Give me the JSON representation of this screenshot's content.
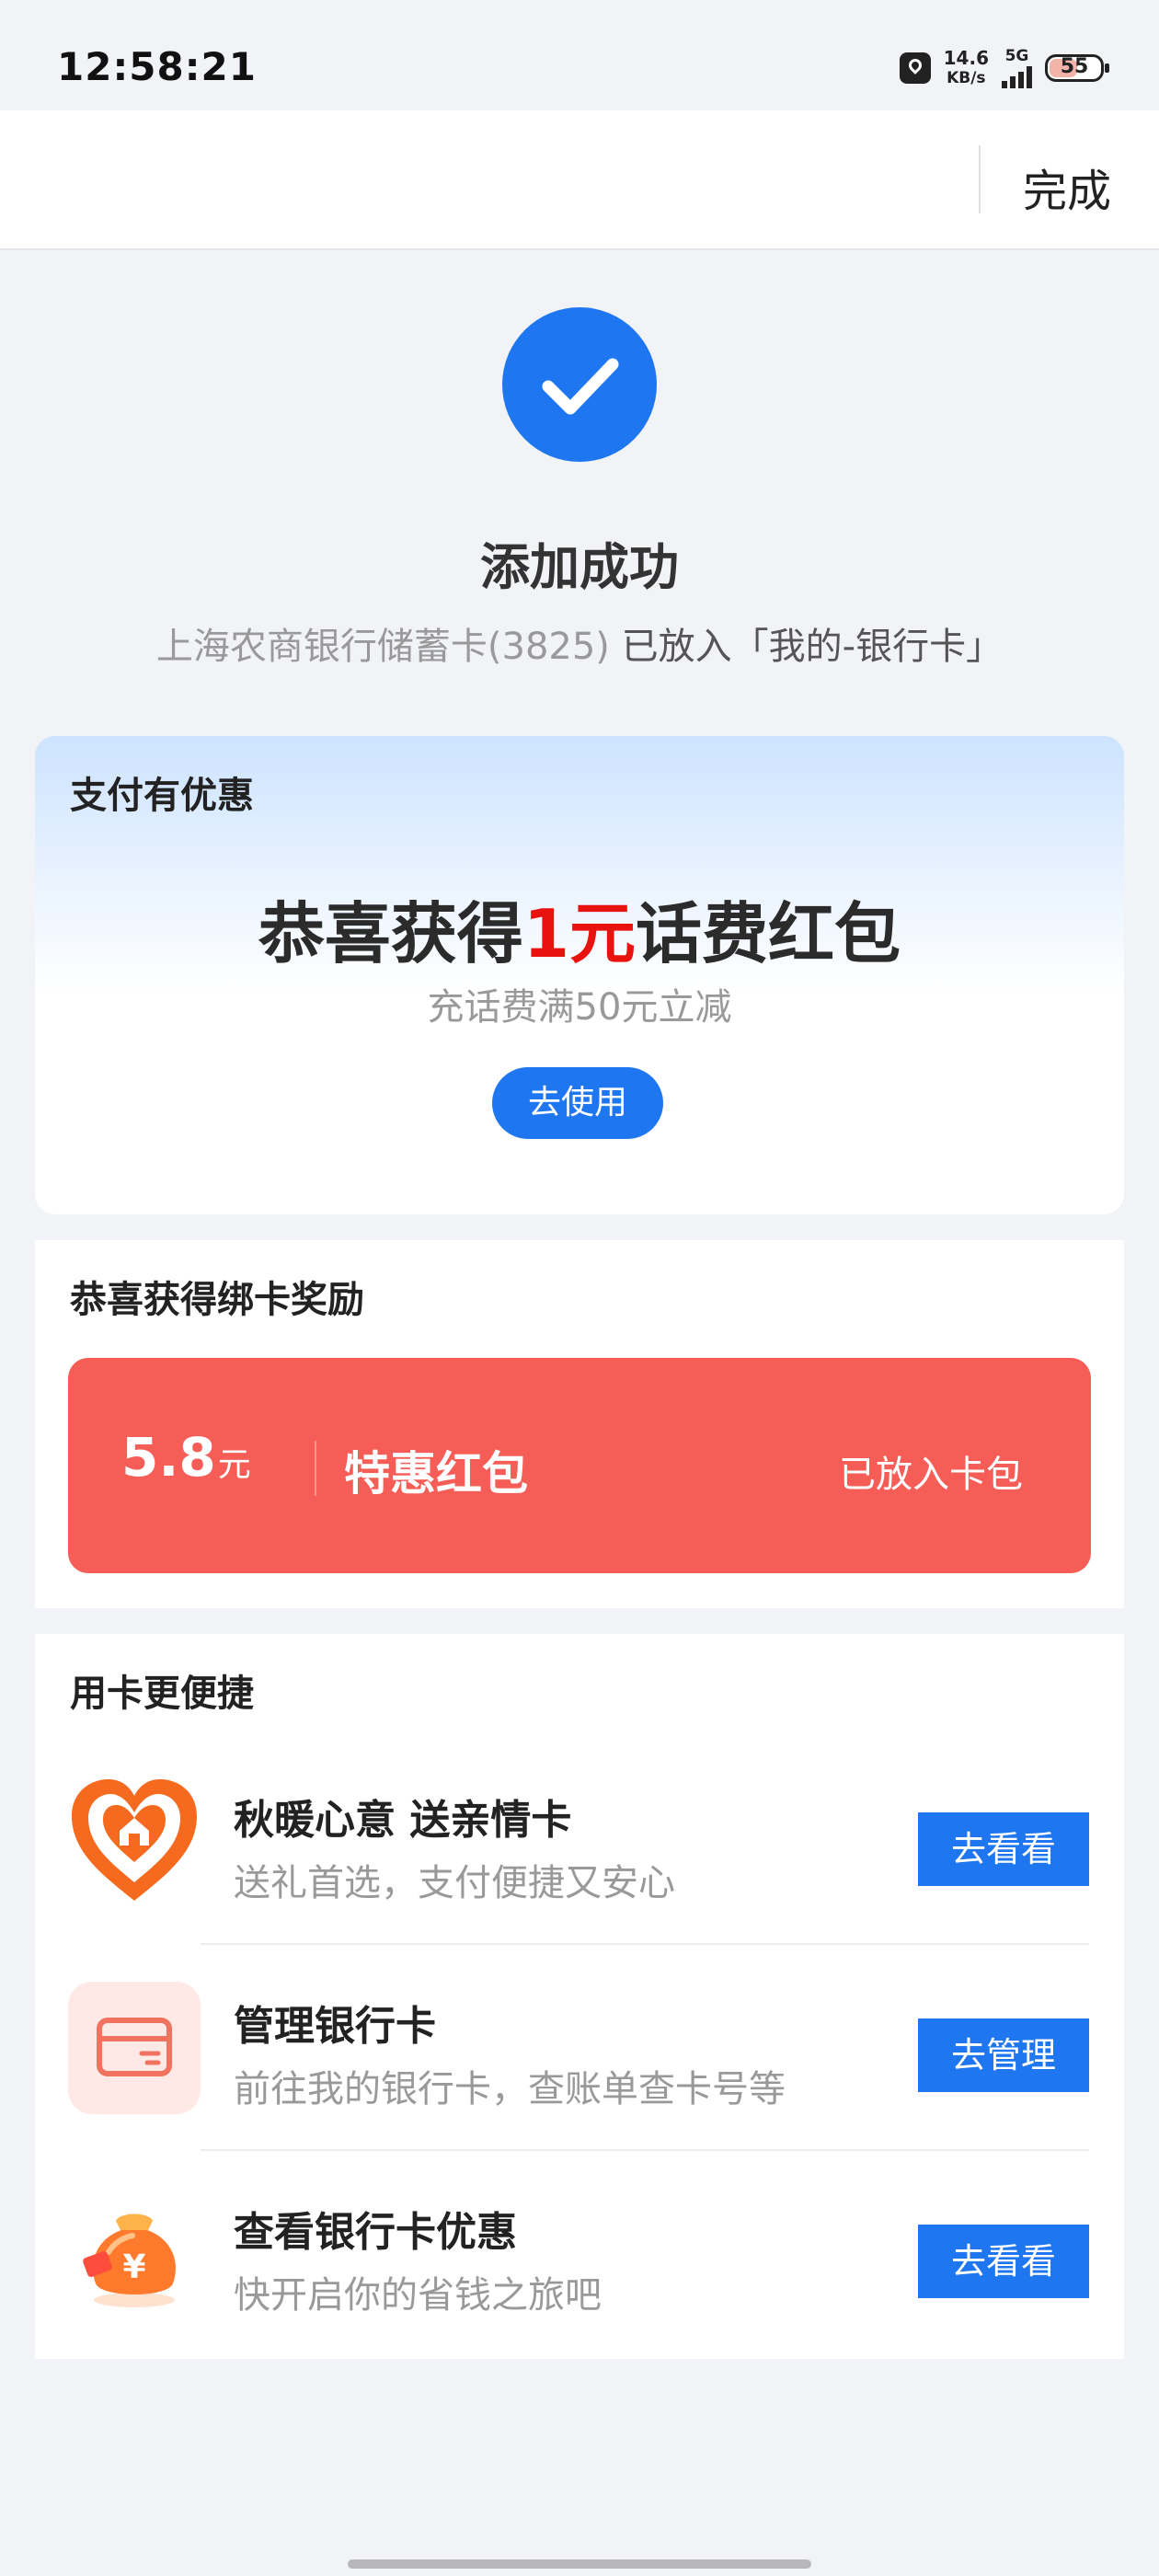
{
  "status_bar": {
    "time": "12:58:21",
    "speed_value": "14.6",
    "speed_unit": "KB/s",
    "network": "5G",
    "battery": "55"
  },
  "header": {
    "done_label": "完成"
  },
  "success": {
    "title": "添加成功",
    "card_name": "上海农商银行储蓄卡(3825)",
    "placed_text": "已放入「我的-银行卡」"
  },
  "promo": {
    "section_title": "支付有优惠",
    "headline_prefix": "恭喜获得",
    "headline_amount": "1元",
    "headline_suffix": "话费红包",
    "condition": "充话费满50元立减",
    "use_button": "去使用"
  },
  "reward": {
    "section_title": "恭喜获得绑卡奖励",
    "amount": "5.8",
    "unit": "元",
    "name": "特惠红包",
    "status": "已放入卡包"
  },
  "convenient": {
    "section_title": "用卡更便捷",
    "items": [
      {
        "title": "秋暖心意 送亲情卡",
        "desc": "送礼首选，支付便捷又安心",
        "button": "去看看",
        "icon": "heart-home-icon"
      },
      {
        "title": "管理银行卡",
        "desc": "前往我的银行卡，查账单查卡号等",
        "button": "去管理",
        "icon": "bank-card-icon"
      },
      {
        "title": "查看银行卡优惠",
        "desc": "快开启你的省钱之旅吧",
        "button": "去看看",
        "icon": "money-bag-icon"
      }
    ]
  },
  "colors": {
    "primary": "#1e76f0",
    "reward_red": "#f65d57",
    "highlight_red": "#e8130f"
  }
}
